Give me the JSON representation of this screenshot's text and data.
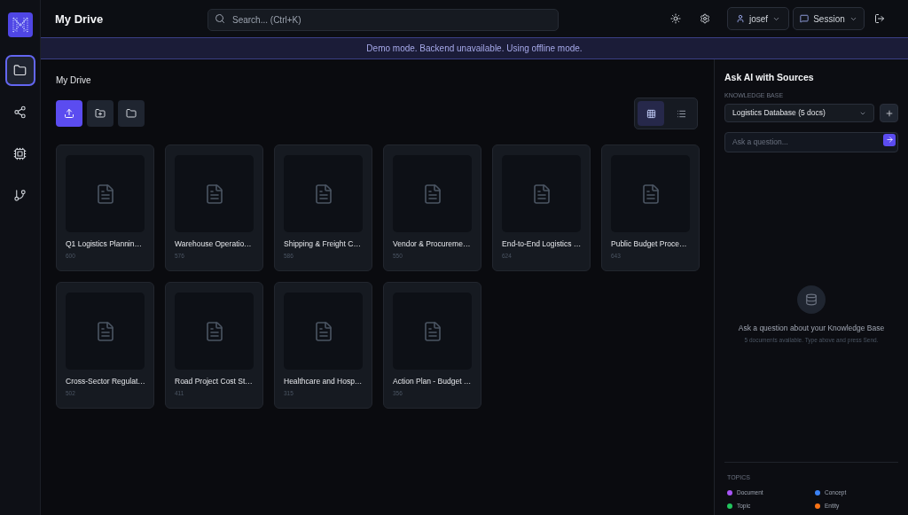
{
  "rail": [
    {
      "kind": "folder",
      "selected": true
    },
    {
      "kind": "share",
      "selected": false
    },
    {
      "kind": "chip",
      "selected": false
    },
    {
      "kind": "branch",
      "selected": false
    }
  ],
  "header": {
    "title": "My Drive",
    "search": {
      "placeholder": "Search... (Ctrl+K)"
    },
    "user": "josef",
    "session": "Session"
  },
  "banner": "Demo mode. Backend unavailable. Using offline mode.",
  "main": {
    "breadcrumb": "My Drive",
    "toolbar": [
      {
        "kind": "upload",
        "primary": true
      },
      {
        "kind": "new-folder",
        "primary": false
      },
      {
        "kind": "folder",
        "primary": false
      }
    ],
    "view_toggle": [
      {
        "kind": "grid",
        "selected": true
      },
      {
        "kind": "list",
        "selected": false
      }
    ],
    "files": [
      {
        "name": "Q1 Logistics Plannin…",
        "count": "600"
      },
      {
        "name": "Warehouse Operatio…",
        "count": "576"
      },
      {
        "name": "Shipping & Freight C…",
        "count": "586"
      },
      {
        "name": "Vendor & Procureme…",
        "count": "550"
      },
      {
        "name": "End-to-End Logistics …",
        "count": "624"
      },
      {
        "name": "Public Budget Proce…",
        "count": "643"
      },
      {
        "name": "Cross-Sector Regulat…",
        "count": "502"
      },
      {
        "name": "Road Project Cost St…",
        "count": "411"
      },
      {
        "name": "Healthcare and Hosp…",
        "count": "315"
      },
      {
        "name": "Action Plan - Budget …",
        "count": "356"
      }
    ]
  },
  "assistant": {
    "title": "Ask AI with Sources",
    "knowledge_base_label": "KNOWLEDGE BASE",
    "knowledge_base": "Logistics Database (5 docs)",
    "question": {
      "placeholder": "Ask a question..."
    },
    "empty_title": "Ask a question about your Knowledge Base",
    "empty_hint": "5 documents available. Type above and press Send."
  },
  "topics": {
    "title": "TOPICS",
    "legend": [
      {
        "label": "Document",
        "color": "#a855f7"
      },
      {
        "label": "Concept",
        "color": "#3b82f6"
      },
      {
        "label": "Topic",
        "color": "#22c55e"
      },
      {
        "label": "Entity",
        "color": "#f97316"
      }
    ]
  }
}
